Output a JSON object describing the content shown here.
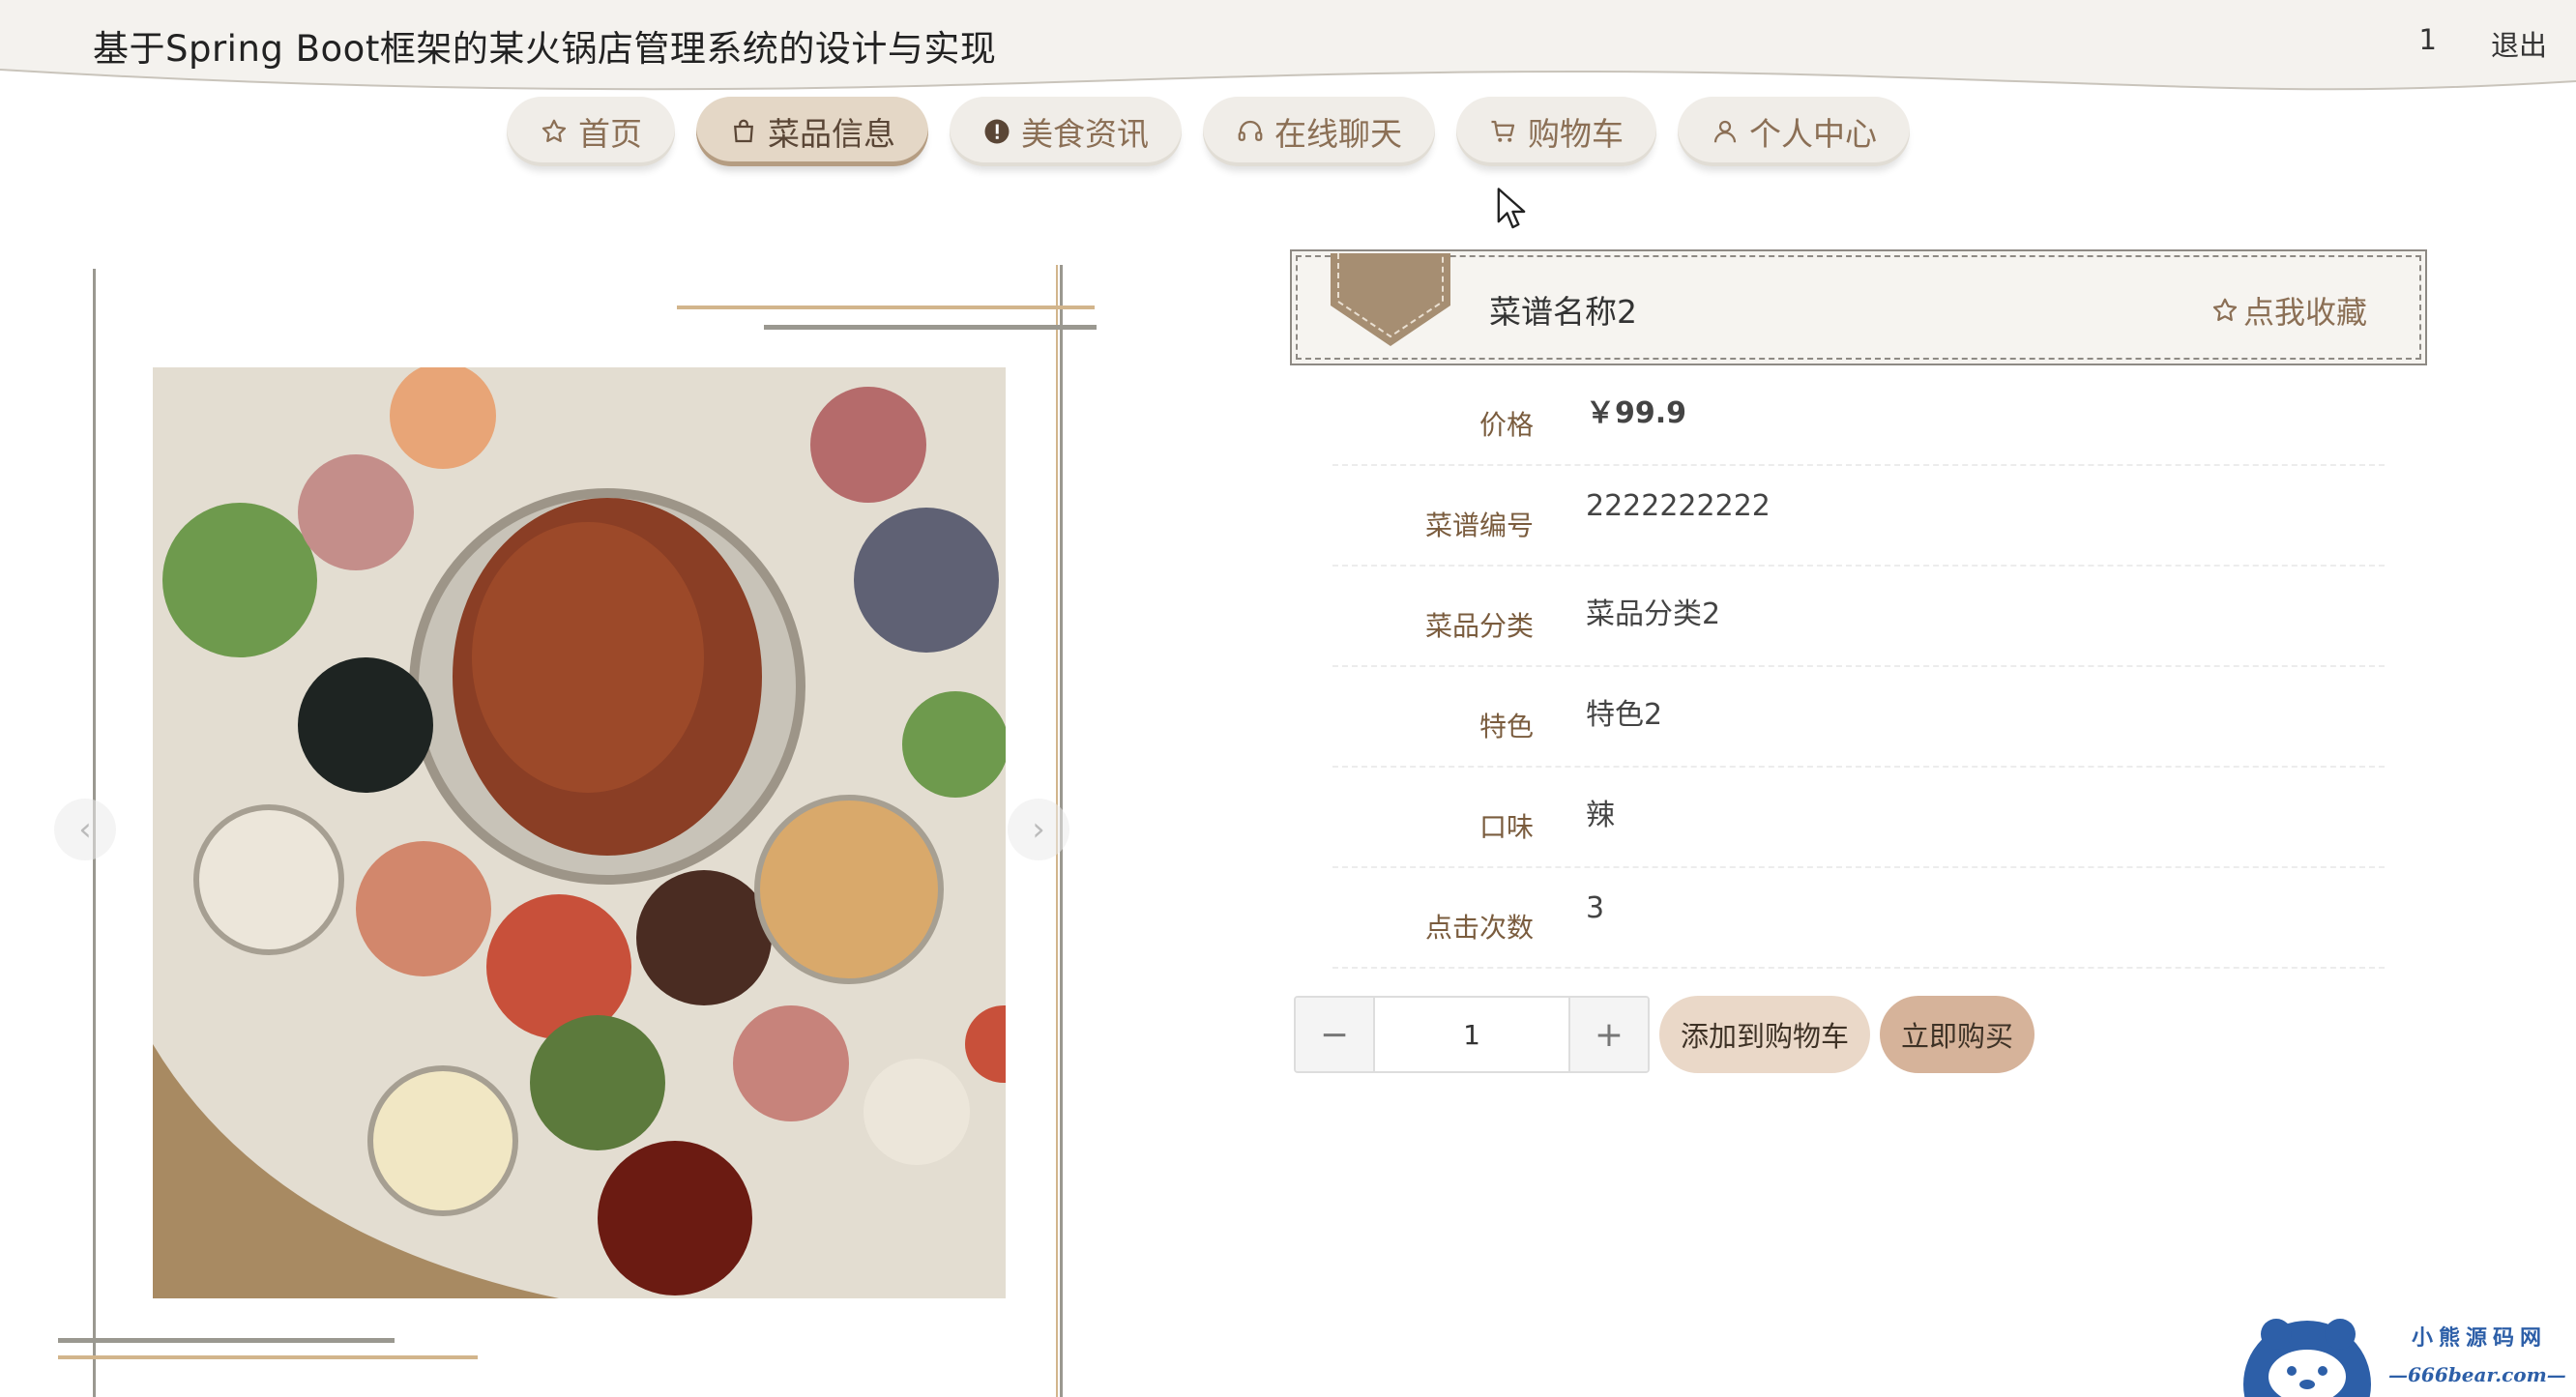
{
  "header": {
    "title": "基于Spring Boot框架的某火锅店管理系统的设计与实现",
    "user": "1",
    "logout": "退出"
  },
  "nav": {
    "items": [
      {
        "label": "首页",
        "icon": "star-icon"
      },
      {
        "label": "菜品信息",
        "icon": "bag-icon",
        "active": true
      },
      {
        "label": "美食资讯",
        "icon": "alert-circle-icon"
      },
      {
        "label": "在线聊天",
        "icon": "headset-icon"
      },
      {
        "label": "购物车",
        "icon": "cart-icon"
      },
      {
        "label": "个人中心",
        "icon": "user-icon"
      }
    ]
  },
  "product": {
    "name": "菜谱名称2",
    "favorite": "点我收藏",
    "fields": [
      {
        "label": "价格",
        "value": "￥99.9"
      },
      {
        "label": "菜谱编号",
        "value": "2222222222"
      },
      {
        "label": "菜品分类",
        "value": "菜品分类2"
      },
      {
        "label": "特色",
        "value": "特色2"
      },
      {
        "label": "口味",
        "value": "辣"
      },
      {
        "label": "点击次数",
        "value": "3"
      }
    ]
  },
  "purchase": {
    "decrement": "−",
    "quantity": "1",
    "increment": "+",
    "add_to_cart": "添加到购物车",
    "buy_now": "立即购买"
  },
  "carousel": {
    "prev": "‹",
    "next": "›"
  },
  "watermark": {
    "line1": "小熊源码网",
    "line2": "—666bear.com—"
  },
  "colors": {
    "accent": "#8b6f55",
    "nav_bg": "#f0ede8",
    "nav_active": "#e4d7c6",
    "buy": "#d6b39a",
    "cart": "#ead8c8"
  }
}
